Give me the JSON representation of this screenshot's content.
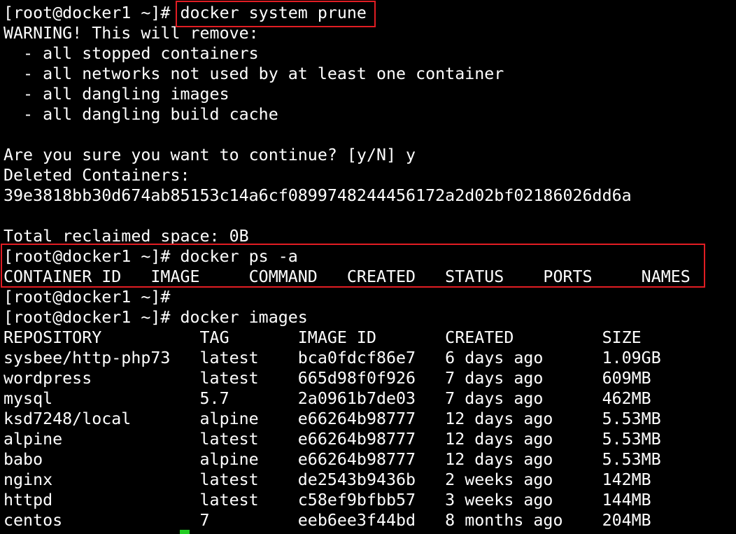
{
  "terminal": {
    "lines": [
      "[root@docker1 ~]# docker system prune",
      "WARNING! This will remove:",
      "  - all stopped containers",
      "  - all networks not used by at least one container",
      "  - all dangling images",
      "  - all dangling build cache",
      "",
      "Are you sure you want to continue? [y/N] y",
      "Deleted Containers:",
      "39e3818bb30d674ab85153c14a6cf0899748244456172a2d02bf02186026dd6a",
      "",
      "Total reclaimed space: 0B",
      "[root@docker1 ~]# docker ps -a",
      "CONTAINER ID   IMAGE     COMMAND   CREATED   STATUS    PORTS     NAMES",
      "[root@docker1 ~]#",
      "[root@docker1 ~]# docker images",
      "REPOSITORY          TAG       IMAGE ID       CREATED         SIZE",
      "sysbee/http-php73   latest    bca0fdcf86e7   6 days ago      1.09GB",
      "wordpress           latest    665d98f0f926   7 days ago      609MB",
      "mysql               5.7       2a0961b7de03   7 days ago      462MB",
      "ksd7248/local       alpine    e66264b98777   12 days ago     5.53MB",
      "alpine              latest    e66264b98777   12 days ago     5.53MB",
      "babo                alpine    e66264b98777   12 days ago     5.53MB",
      "nginx               latest    de2543b9436b   2 weeks ago     142MB",
      "httpd               latest    c58ef9bfbb57   3 weeks ago     144MB",
      "centos              7         eeb6ee3f44bd   8 months ago    204MB"
    ],
    "colors": {
      "background": "#000000",
      "text": "#ffffff",
      "highlight_border": "#e11d23",
      "cursor": "#22cc22"
    }
  }
}
